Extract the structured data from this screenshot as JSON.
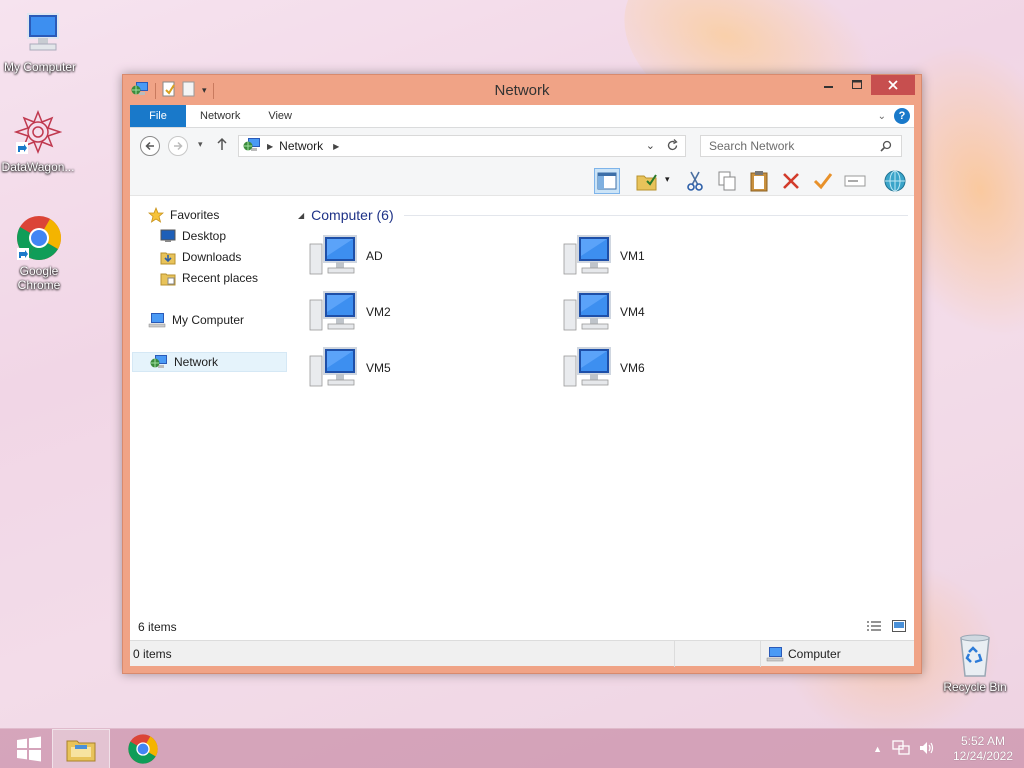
{
  "desktop": {
    "icons": [
      {
        "label": "My Computer"
      },
      {
        "label": "DataWagon..."
      },
      {
        "label": "Google Chrome"
      },
      {
        "label": "Recycle Bin"
      }
    ]
  },
  "window": {
    "title": "Network",
    "ribbon_tabs": [
      "File",
      "Network",
      "View"
    ],
    "address": {
      "root": "Network"
    },
    "search": {
      "placeholder": "Search Network"
    },
    "navigation": {
      "favorites": "Favorites",
      "favorite_items": [
        "Desktop",
        "Downloads",
        "Recent places"
      ],
      "my_computer": "My Computer",
      "network": "Network"
    },
    "group": {
      "label": "Computer (6)"
    },
    "computers": [
      "AD",
      "VM1",
      "VM2",
      "VM4",
      "VM5",
      "VM6"
    ],
    "status": {
      "item_count": "6 items",
      "selected_count": "0 items",
      "zone": "Computer"
    }
  },
  "taskbar": {
    "time": "5:52 AM",
    "date": "12/24/2022"
  },
  "colors": {
    "accent": "#1979ca",
    "window_frame": "#f0a386",
    "close_button": "#c74f4f",
    "group_label": "#1e3287"
  }
}
